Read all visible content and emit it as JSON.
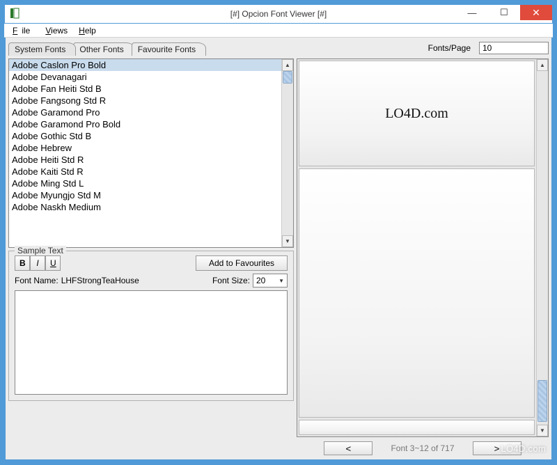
{
  "window": {
    "title": "[#] Opcion Font Viewer [#]"
  },
  "menu": {
    "file": "File",
    "views": "Views",
    "help": "Help"
  },
  "tabs": {
    "system": "System Fonts",
    "other": "Other Fonts",
    "favourite": "Favourite Fonts"
  },
  "font_list": [
    "Adobe Caslon Pro Bold",
    "Adobe Devanagari",
    "Adobe Fan Heiti Std B",
    "Adobe Fangsong Std R",
    "Adobe Garamond Pro",
    "Adobe Garamond Pro Bold",
    "Adobe Gothic Std B",
    "Adobe Hebrew",
    "Adobe Heiti Std R",
    "Adobe Kaiti Std R",
    "Adobe Ming Std L",
    "Adobe Myungjo Std M",
    "Adobe Naskh Medium"
  ],
  "sample": {
    "legend": "Sample Text",
    "bold": "B",
    "italic": "I",
    "underline": "U",
    "add_fav": "Add to Favourites",
    "font_name_label": "Font Name:",
    "font_name_value": "LHFStrongTeaHouse",
    "font_size_label": "Font Size:",
    "font_size_value": "20"
  },
  "right": {
    "fonts_per_page_label": "Fonts/Page",
    "fonts_per_page_value": "10",
    "preview_text": "LO4D.com"
  },
  "nav": {
    "prev": "<",
    "status": "Font 3~12 of 717",
    "next": ">"
  },
  "watermark": "LO4D.com"
}
